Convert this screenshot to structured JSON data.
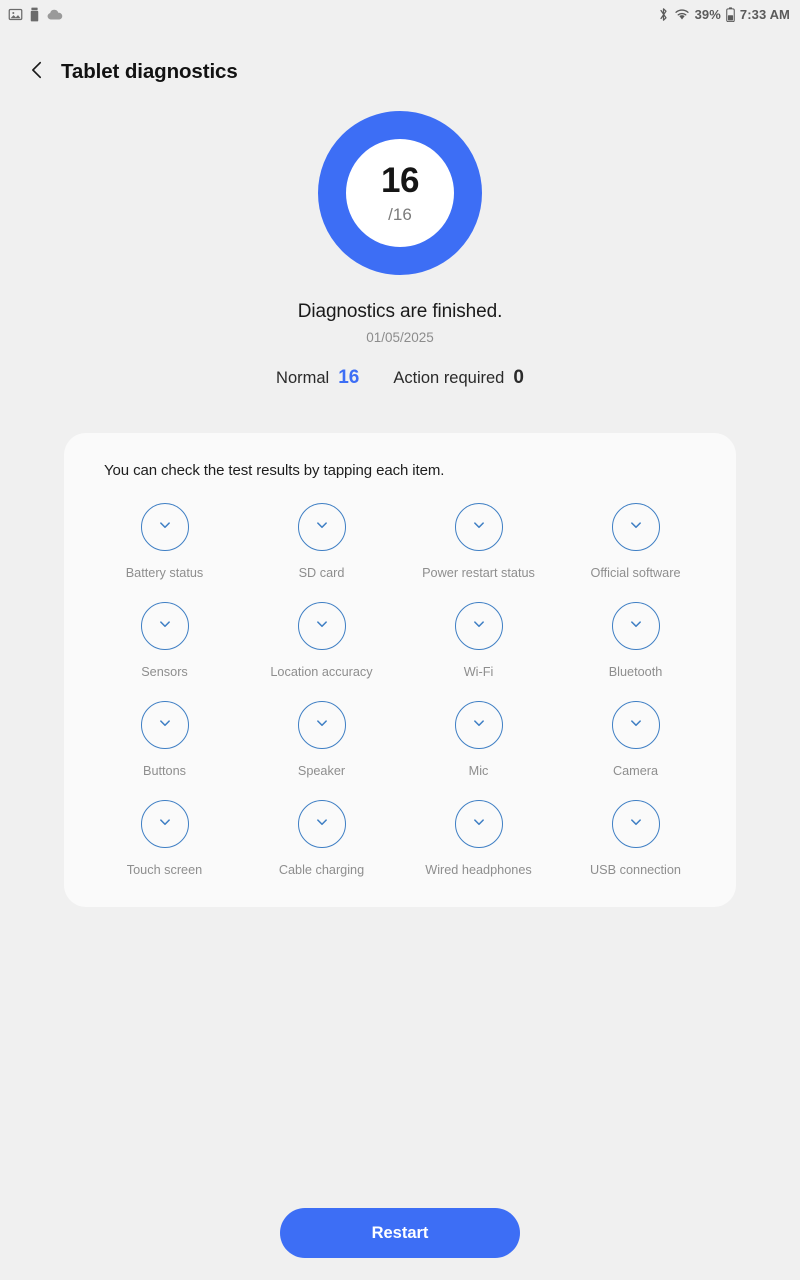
{
  "status_bar": {
    "left_icons": [
      "photo-icon",
      "usb-storage-icon",
      "cloud-icon"
    ],
    "right_icons": [
      "bluetooth-icon",
      "wifi-icon",
      "battery-icon"
    ],
    "battery_percent": "39%",
    "time": "7:33 AM"
  },
  "app_bar": {
    "back_icon": "chevron-left-icon",
    "title": "Tablet diagnostics"
  },
  "progress": {
    "score": "16",
    "total": "/16",
    "percent": 100,
    "ring_color": "#3d6ef5",
    "ring_track_color": "#ffffff"
  },
  "summary": {
    "title": "Diagnostics are finished.",
    "date": "01/05/2025",
    "normal_label": "Normal",
    "normal_value": "16",
    "normal_color": "#3d6ef5",
    "action_label": "Action required",
    "action_value": "0",
    "action_color": "#2b2b2b"
  },
  "results": {
    "hint": "You can check the test results by tapping each item.",
    "item_icon": "chevron-down-icon",
    "item_color": "#3f7fc4",
    "items": [
      {
        "label": "Battery status"
      },
      {
        "label": "SD card"
      },
      {
        "label": "Power restart status"
      },
      {
        "label": "Official software"
      },
      {
        "label": "Sensors"
      },
      {
        "label": "Location accuracy"
      },
      {
        "label": "Wi-Fi"
      },
      {
        "label": "Bluetooth"
      },
      {
        "label": "Buttons"
      },
      {
        "label": "Speaker"
      },
      {
        "label": "Mic"
      },
      {
        "label": "Camera"
      },
      {
        "label": "Touch screen"
      },
      {
        "label": "Cable charging"
      },
      {
        "label": "Wired headphones"
      },
      {
        "label": "USB connection"
      }
    ]
  },
  "footer": {
    "restart_label": "Restart",
    "restart_color": "#3d6ef5"
  }
}
